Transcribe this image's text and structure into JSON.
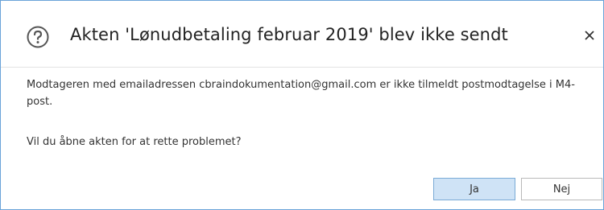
{
  "dialog": {
    "icon": "help-icon",
    "title": "Akten 'Lønudbetaling februar 2019' blev ikke sendt",
    "close_glyph": "×",
    "message": "Modtageren med emailadressen cbraindokumentation@gmail.com er ikke tilmeldt postmodtagelse i M4-post.",
    "question": "Vil du åbne akten for at rette problemet?",
    "buttons": {
      "yes_label": "Ja",
      "no_label": "Nej"
    }
  },
  "colors": {
    "accent_border": "#6aa3d8",
    "primary_button_bg": "#cfe3f6",
    "primary_button_border": "#7aaad6"
  }
}
